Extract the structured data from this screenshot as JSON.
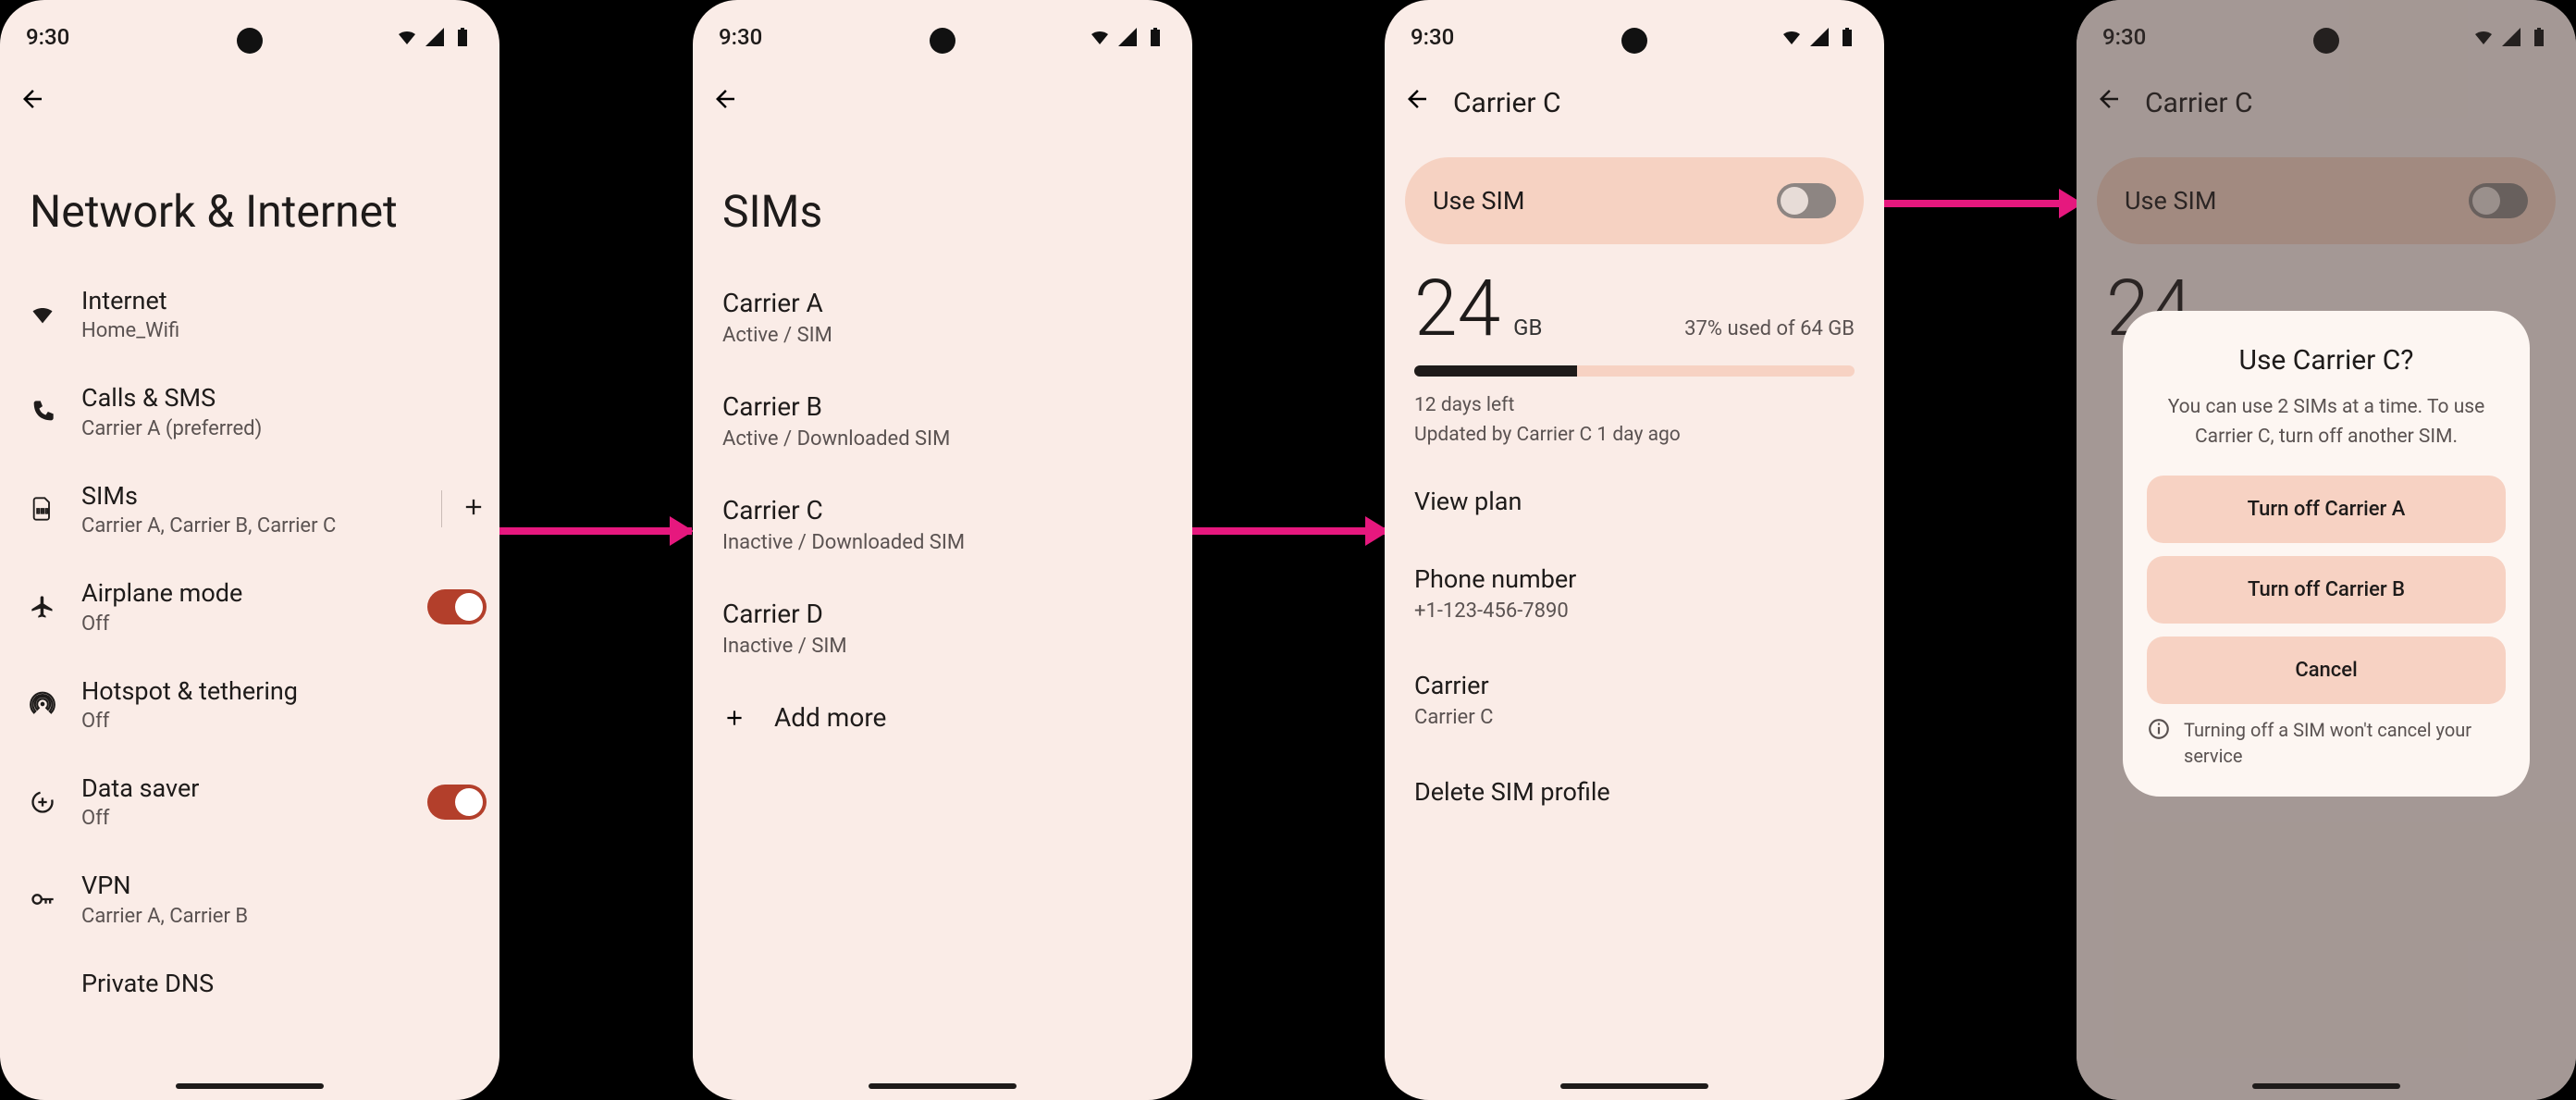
{
  "statusbar": {
    "time": "9:30"
  },
  "screen1": {
    "page_title": "Network & Internet",
    "internet": {
      "title": "Internet",
      "sub": "Home_Wifi"
    },
    "calls": {
      "title": "Calls & SMS",
      "sub": "Carrier A (preferred)"
    },
    "sims": {
      "title": "SIMs",
      "sub": "Carrier A, Carrier B, Carrier C"
    },
    "airplane": {
      "title": "Airplane mode",
      "sub": "Off"
    },
    "hotspot": {
      "title": "Hotspot & tethering",
      "sub": "Off"
    },
    "datasaver": {
      "title": "Data saver",
      "sub": "Off"
    },
    "vpn": {
      "title": "VPN",
      "sub": "Carrier A, Carrier B"
    },
    "private_dns": {
      "title": "Private DNS"
    }
  },
  "screen2": {
    "page_title": "SIMs",
    "carriers": {
      "a": {
        "name": "Carrier A",
        "status": "Active / SIM"
      },
      "b": {
        "name": "Carrier B",
        "status": "Active / Downloaded SIM"
      },
      "c": {
        "name": "Carrier C",
        "status": "Inactive / Downloaded SIM"
      },
      "d": {
        "name": "Carrier D",
        "status": "Inactive / SIM"
      }
    },
    "add_more": "Add more"
  },
  "screen3": {
    "appbar_title": "Carrier C",
    "use_sim_label": "Use SIM",
    "usage": {
      "amount": "24",
      "unit": "GB",
      "used_text": "37% used of 64 GB",
      "percent": 37,
      "days_left": "12 days left",
      "updated": "Updated by Carrier C 1 day ago"
    },
    "view_plan": "View plan",
    "phone": {
      "label": "Phone number",
      "value": "+1-123-456-7890"
    },
    "carrier": {
      "label": "Carrier",
      "value": "Carrier C"
    },
    "delete": "Delete SIM profile"
  },
  "screen4": {
    "appbar_title": "Carrier C",
    "use_sim_label": "Use SIM",
    "usage_amount": "24",
    "dialog": {
      "title": "Use Carrier C?",
      "message": "You can use 2 SIMs at a time. To use Carrier C, turn off another SIM.",
      "btn_a": "Turn off Carrier A",
      "btn_b": "Turn off Carrier B",
      "btn_cancel": "Cancel",
      "footer": "Turning off a SIM won't cancel your service"
    }
  }
}
